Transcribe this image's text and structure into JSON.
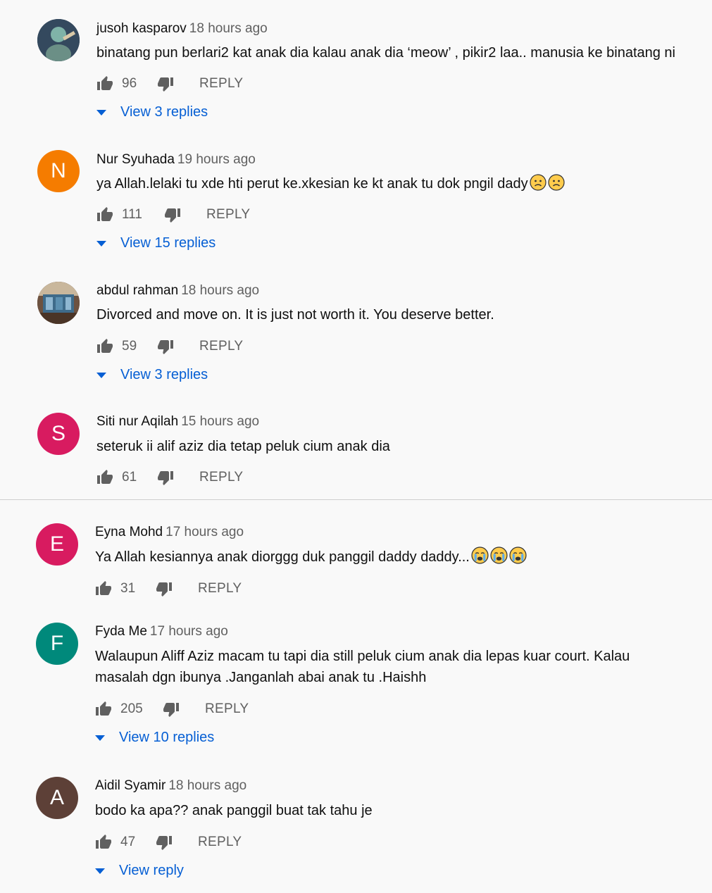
{
  "comments": [
    {
      "avatar_type": "image",
      "avatar_color": "#2e3e4e",
      "author": "jusoh kasparov",
      "time": "18 hours ago",
      "text": "binatang pun berlari2 kat anak dia kalau anak dia ‘meow’ , pikir2 laa.. manusia ke binatang ni",
      "likes": "96",
      "reply_label": "REPLY",
      "replies_label": "View 3 replies"
    },
    {
      "avatar_type": "letter",
      "avatar_letter": "N",
      "avatar_color": "#f57c00",
      "author": "Nur Syuhada",
      "time": "19 hours ago",
      "text": "ya Allah.lelaki tu xde hti perut ke.xkesian ke kt anak tu dok pngil dady",
      "emojis": [
        "sad-face-emoji",
        "sad-face-emoji"
      ],
      "likes": "111",
      "reply_label": "REPLY",
      "replies_label": "View 15 replies"
    },
    {
      "avatar_type": "image",
      "avatar_color": "#5a4030",
      "author": "abdul rahman",
      "time": "18 hours ago",
      "text": "Divorced and move on. It is just not worth it. You deserve better.",
      "likes": "59",
      "reply_label": "REPLY",
      "replies_label": "View 3 replies"
    },
    {
      "avatar_type": "letter",
      "avatar_letter": "S",
      "avatar_color": "#d81b60",
      "author": "Siti nur Aqilah",
      "time": "15 hours ago",
      "text": "seteruk ii alif aziz dia tetap peluk cium anak dia",
      "likes": "61",
      "reply_label": "REPLY"
    },
    {
      "avatar_type": "letter",
      "avatar_letter": "E",
      "avatar_color": "#d81b60",
      "author": "Eyna Mohd",
      "time": "17 hours ago",
      "text": "Ya Allah kesiannya anak diorggg duk panggil daddy daddy...",
      "emojis": [
        "crying-face-emoji",
        "crying-face-emoji",
        "crying-face-emoji"
      ],
      "likes": "31",
      "reply_label": "REPLY"
    },
    {
      "avatar_type": "letter",
      "avatar_letter": "F",
      "avatar_color": "#00897b",
      "author": "Fyda Me",
      "time": "17 hours ago",
      "text": "Walaupun Aliff Aziz macam tu tapi dia still peluk cium anak dia lepas kuar court. Kalau masalah dgn ibunya .Janganlah abai anak tu .Haishh",
      "likes": "205",
      "reply_label": "REPLY",
      "replies_label": "View 10 replies"
    },
    {
      "avatar_type": "letter",
      "avatar_letter": "A",
      "avatar_color": "#5d4037",
      "author": "Aidil Syamir",
      "time": "18 hours ago",
      "text": "bodo ka apa?? anak panggil buat tak tahu je",
      "likes": "47",
      "reply_label": "REPLY",
      "replies_label": "View reply"
    }
  ]
}
